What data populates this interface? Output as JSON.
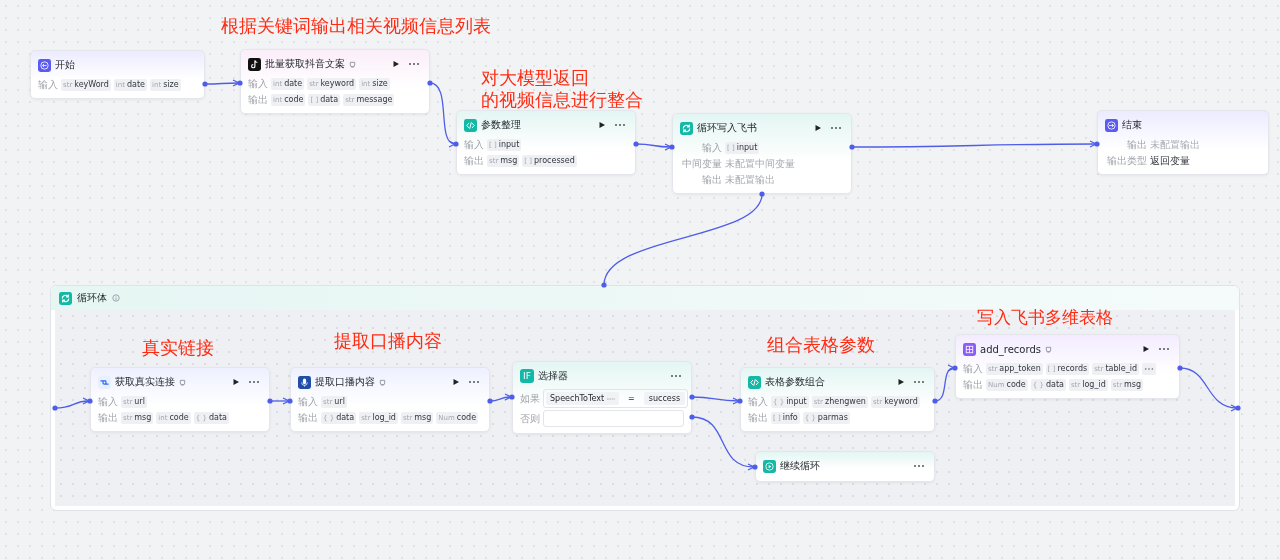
{
  "annotations": [
    {
      "text": "根据关键词输出相关视频信息列表"
    },
    {
      "text": "对大模型返回"
    },
    {
      "text": "的视频信息进行整合"
    },
    {
      "text": "真实链接"
    },
    {
      "text": "提取口播内容"
    },
    {
      "text": "组合表格参数"
    },
    {
      "text": "写入飞书多维表格"
    }
  ],
  "nodes": [
    {
      "title": "开始",
      "rows": [
        {
          "kind": "params",
          "label": "输入",
          "params": [
            {
              "type": "str",
              "name": "keyWord"
            },
            {
              "type": "int",
              "name": "date"
            },
            {
              "type": "int",
              "name": "size"
            }
          ]
        }
      ]
    },
    {
      "title": "批量获取抖音文案",
      "rows": [
        {
          "kind": "params",
          "label": "输入",
          "params": [
            {
              "type": "int",
              "name": "date"
            },
            {
              "type": "str",
              "name": "keyword"
            },
            {
              "type": "int",
              "name": "size"
            }
          ]
        },
        {
          "kind": "params",
          "label": "输出",
          "params": [
            {
              "type": "int",
              "name": "code"
            },
            {
              "type": "[ ]",
              "name": "data"
            },
            {
              "type": "str",
              "name": "message"
            }
          ]
        }
      ]
    },
    {
      "title": "参数整理",
      "rows": [
        {
          "kind": "params",
          "label": "输入",
          "params": [
            {
              "type": "[ ]",
              "name": "input"
            }
          ]
        },
        {
          "kind": "params",
          "label": "输出",
          "params": [
            {
              "type": "str",
              "name": "msg"
            },
            {
              "type": "[ ]",
              "name": "processed"
            }
          ]
        }
      ]
    },
    {
      "title": "循环写入飞书",
      "rows": [
        {
          "kind": "params",
          "label": "输入",
          "params": [
            {
              "type": "[ ]",
              "name": "input"
            }
          ]
        },
        {
          "kind": "text",
          "label": "中间变量",
          "value": "未配置中间变量",
          "muted": true
        },
        {
          "kind": "text",
          "label": "输出",
          "value": "未配置输出",
          "muted": true
        }
      ]
    },
    {
      "title": "结束",
      "rows": [
        {
          "kind": "text",
          "label": "输出",
          "value": "未配置输出",
          "muted": true
        },
        {
          "kind": "text",
          "label": "输出类型",
          "value": "返回变量",
          "muted": false
        }
      ]
    },
    {
      "title": "获取真实连接",
      "rows": [
        {
          "kind": "params",
          "label": "输入",
          "params": [
            {
              "type": "str",
              "name": "url"
            }
          ]
        },
        {
          "kind": "params",
          "label": "输出",
          "params": [
            {
              "type": "str",
              "name": "msg"
            },
            {
              "type": "int",
              "name": "code"
            },
            {
              "type": "{ }",
              "name": "data"
            }
          ]
        }
      ]
    },
    {
      "title": "提取口播内容",
      "rows": [
        {
          "kind": "params",
          "label": "输入",
          "params": [
            {
              "type": "str",
              "name": "url"
            }
          ]
        },
        {
          "kind": "params",
          "label": "输出",
          "params": [
            {
              "type": "{ }",
              "name": "data"
            },
            {
              "type": "str",
              "name": "log_id"
            },
            {
              "type": "str",
              "name": "msg"
            },
            {
              "type": "Num",
              "name": "code"
            }
          ]
        }
      ]
    },
    {
      "title": "选择器",
      "icon_text": "IF",
      "rows": [
        {
          "kind": "condition",
          "label": "如果",
          "left": "SpeechToText",
          "op": "=",
          "right": "success"
        },
        {
          "kind": "field",
          "label": "否则"
        }
      ]
    },
    {
      "title": "表格参数组合",
      "rows": [
        {
          "kind": "params",
          "label": "输入",
          "params": [
            {
              "type": "{ }",
              "name": "input"
            },
            {
              "type": "str",
              "name": "zhengwen"
            },
            {
              "type": "str",
              "name": "keyword"
            }
          ]
        },
        {
          "kind": "params",
          "label": "输出",
          "params": [
            {
              "type": "[ ]",
              "name": "info"
            },
            {
              "type": "{ }",
              "name": "parmas"
            }
          ]
        }
      ]
    },
    {
      "title": "继续循环"
    },
    {
      "title": "add_records",
      "rows": [
        {
          "kind": "params",
          "label": "输入",
          "overflow": true,
          "params": [
            {
              "type": "str",
              "name": "app_token"
            },
            {
              "type": "[ ]",
              "name": "records"
            },
            {
              "type": "str",
              "name": "table_id"
            }
          ]
        },
        {
          "kind": "params",
          "label": "输出",
          "params": [
            {
              "type": "Num",
              "name": "code"
            },
            {
              "type": "{ }",
              "name": "data"
            },
            {
              "type": "str",
              "name": "log_id"
            },
            {
              "type": "str",
              "name": "msg"
            }
          ]
        }
      ]
    }
  ],
  "loop_body": {
    "title": "循环体"
  }
}
